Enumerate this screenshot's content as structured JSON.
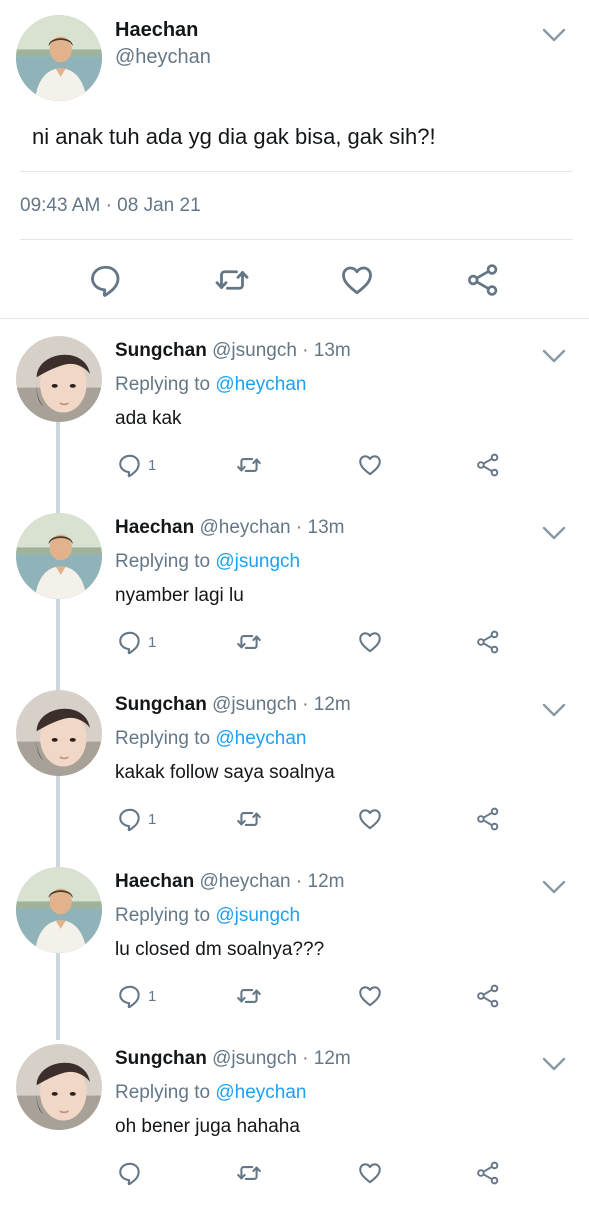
{
  "main_tweet": {
    "name": "Haechan",
    "handle": "@heychan",
    "text": "ni anak tuh ada yg dia gak bisa, gak sih?!",
    "time": "09:43 AM",
    "separator": "·",
    "date": "08 Jan 21"
  },
  "replies": [
    {
      "name": "Sungchan",
      "handle": "@jsungch",
      "age": "· 13m",
      "replying_prefix": "Replying to",
      "replying_to": "@heychan",
      "text": "ada kak",
      "reply_count": "1",
      "avatar": "sungchan"
    },
    {
      "name": "Haechan",
      "handle": "@heychan",
      "age": "· 13m",
      "replying_prefix": "Replying to",
      "replying_to": "@jsungch",
      "text": "nyamber lagi lu",
      "reply_count": "1",
      "avatar": "haechan"
    },
    {
      "name": "Sungchan",
      "handle": "@jsungch",
      "age": "· 12m",
      "replying_prefix": "Replying to",
      "replying_to": "@heychan",
      "text": "kakak follow saya soalnya",
      "reply_count": "1",
      "avatar": "sungchan"
    },
    {
      "name": "Haechan",
      "handle": "@heychan",
      "age": "· 12m",
      "replying_prefix": "Replying to",
      "replying_to": "@jsungch",
      "text": "lu closed dm soalnya???",
      "reply_count": "1",
      "avatar": "haechan"
    },
    {
      "name": "Sungchan",
      "handle": "@jsungch",
      "age": "· 12m",
      "replying_prefix": "Replying to",
      "replying_to": "@heychan",
      "text": "oh bener juga hahaha",
      "reply_count": "",
      "avatar": "sungchan"
    }
  ],
  "icons": {
    "reply": "speech-bubble-icon",
    "retweet": "retweet-arrows-icon",
    "like": "heart-outline-icon",
    "share": "share-nodes-icon",
    "more": "chevron-down-icon"
  },
  "colors": {
    "text": "#14171a",
    "secondary": "#657786",
    "link": "#1da1f2",
    "divider": "#e1e8ed",
    "thread_line": "#ccd6dd"
  }
}
